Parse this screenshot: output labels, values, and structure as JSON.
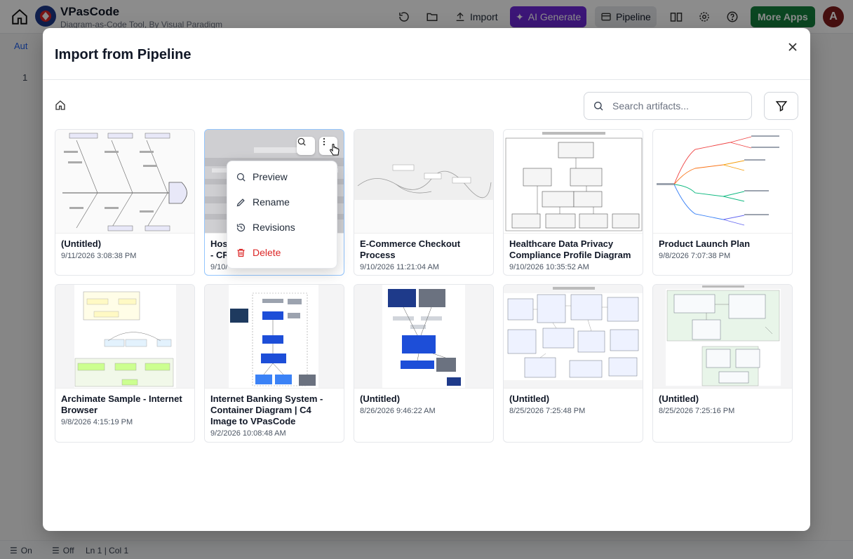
{
  "app": {
    "title": "VPasCode",
    "subtitle": "Diagram-as-Code Tool, By Visual Paradigm",
    "import_label": "Import",
    "ai_label": "AI Generate",
    "pipeline_label": "Pipeline",
    "more_apps_label": "More Apps",
    "avatar_letter": "A",
    "editor_tab": "Aut",
    "line_number": "1"
  },
  "statusbar": {
    "toggle1": "On",
    "toggle2": "Off",
    "cursor_pos": "Ln 1 | Col 1"
  },
  "modal": {
    "title": "Import from Pipeline",
    "search_placeholder": "Search artifacts..."
  },
  "artifacts": [
    {
      "title": "(Untitled)",
      "date": "9/11/2026 3:08:38 PM"
    },
    {
      "title": "Hos",
      "title2": "- CR",
      "date": "9/10/"
    },
    {
      "title": "E-Commerce Checkout Process",
      "date": "9/10/2026 11:21:04 AM"
    },
    {
      "title": "Healthcare Data Privacy Compliance Profile Diagram",
      "date": "9/10/2026 10:35:52 AM"
    },
    {
      "title": "Product Launch Plan",
      "date": "9/8/2026 7:07:38 PM"
    },
    {
      "title": "Archimate Sample - Internet Browser",
      "date": "9/8/2026 4:15:19 PM"
    },
    {
      "title": "Internet Banking System - Container Diagram | C4 Image to VPasCode",
      "date": "9/2/2026 10:08:48 AM"
    },
    {
      "title": "(Untitled)",
      "date": "8/26/2026 9:46:22 AM"
    },
    {
      "title": "(Untitled)",
      "date": "8/25/2026 7:25:48 PM"
    },
    {
      "title": "(Untitled)",
      "date": "8/25/2026 7:25:16 PM"
    }
  ],
  "context_menu": {
    "preview": "Preview",
    "rename": "Rename",
    "revisions": "Revisions",
    "delete": "Delete"
  },
  "colors": {
    "ai_button": "#6d28d9",
    "more_apps_button": "#15803d",
    "delete_red": "#dc2626",
    "selected_border": "#93c5fd"
  }
}
